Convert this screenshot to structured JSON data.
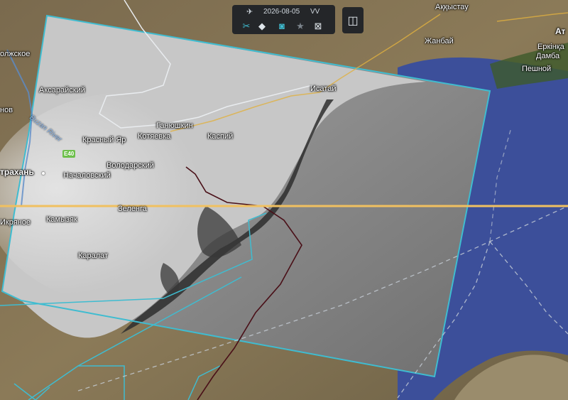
{
  "toolbar": {
    "date": "2026-08-05",
    "polarization": "VV",
    "icons": [
      "satellite-icon",
      "tools-icon",
      "layers-icon",
      "camera-icon",
      "star-icon",
      "export-icon"
    ]
  },
  "compare_button": {
    "icon": "compare-split-icon"
  },
  "map": {
    "places": [
      {
        "id": "akkystau",
        "text": "Аққыстау"
      },
      {
        "id": "zhanbai",
        "text": "Жанбай"
      },
      {
        "id": "at",
        "text": "Ат"
      },
      {
        "id": "erkinka",
        "text": "Еркінқа"
      },
      {
        "id": "damba",
        "text": "Дамба"
      },
      {
        "id": "peshnoi",
        "text": "Пешной"
      },
      {
        "id": "volzhskoe",
        "text": "олжское"
      },
      {
        "id": "aksaraisky",
        "text": "Аксарайский"
      },
      {
        "id": "nov",
        "text": "нов"
      },
      {
        "id": "isatai",
        "text": "Исатай"
      },
      {
        "id": "ganyushkin",
        "text": "Ганюшкин"
      },
      {
        "id": "kaspii",
        "text": "Каспий"
      },
      {
        "id": "krasny_yar",
        "text": "Красный Яр"
      },
      {
        "id": "kotyaevka",
        "text": "Котяевка"
      },
      {
        "id": "volodarsky",
        "text": "Володарский"
      },
      {
        "id": "astrakhan",
        "text": "трахань"
      },
      {
        "id": "nachalovsky",
        "text": "Началовский"
      },
      {
        "id": "zelenga",
        "text": "Зеленга"
      },
      {
        "id": "ikryanoe",
        "text": "Икряное"
      },
      {
        "id": "kamyzyak",
        "text": "Камызяк"
      },
      {
        "id": "karalat",
        "text": "Каралат"
      }
    ],
    "river_label": "Buzan River",
    "road_shield": "E40",
    "colors": {
      "sea": "#3c4f9a",
      "footprint_outline": "#3fbcd0",
      "latitude_line": "#f0c060",
      "border_line": "#c8d0d8",
      "track_line": "#4a1018"
    }
  }
}
